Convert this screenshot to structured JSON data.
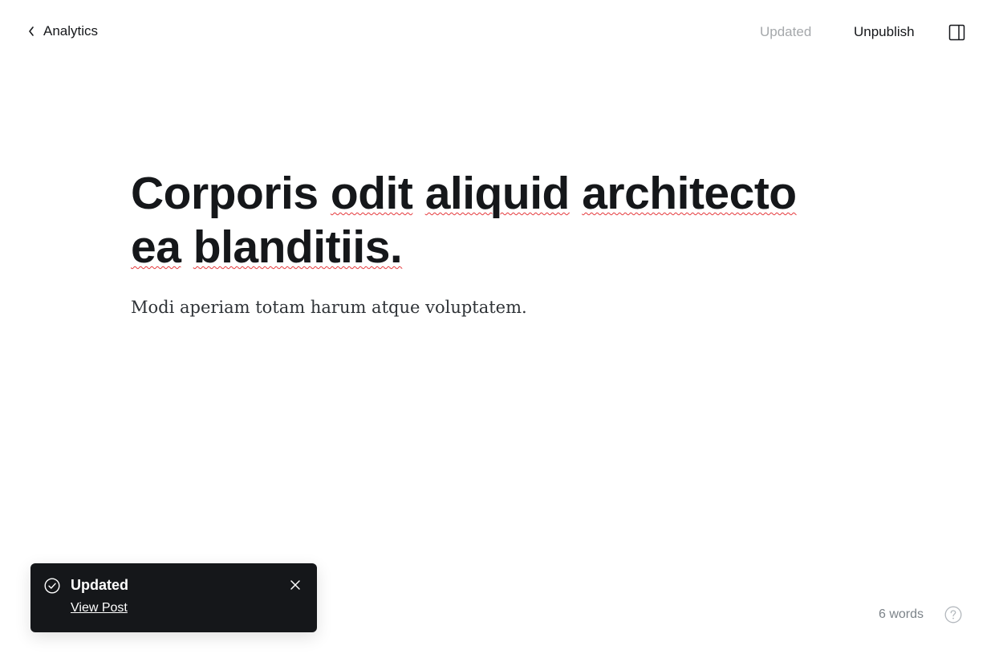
{
  "header": {
    "back_label": "Analytics",
    "status": "Updated",
    "unpublish_label": "Unpublish"
  },
  "post": {
    "title_words": [
      "Corporis",
      "odit",
      "aliquid",
      "architecto",
      "ea",
      "blanditiis."
    ],
    "title": "Corporis odit aliquid architecto ea blanditiis.",
    "body": "Modi aperiam totam harum atque voluptatem."
  },
  "toast": {
    "title": "Updated",
    "link": "View Post"
  },
  "footer": {
    "word_count": "6 words"
  },
  "icons": {
    "back": "chevron-left-icon",
    "sidebar": "sidebar-toggle-icon",
    "toast": "check-circle-icon",
    "close": "close-icon",
    "help": "help-circle-icon"
  },
  "colors": {
    "text_primary": "#15171a",
    "text_muted": "#a5a8ab",
    "toast_bg": "#15171a",
    "spell_underline": "#e5383b"
  }
}
